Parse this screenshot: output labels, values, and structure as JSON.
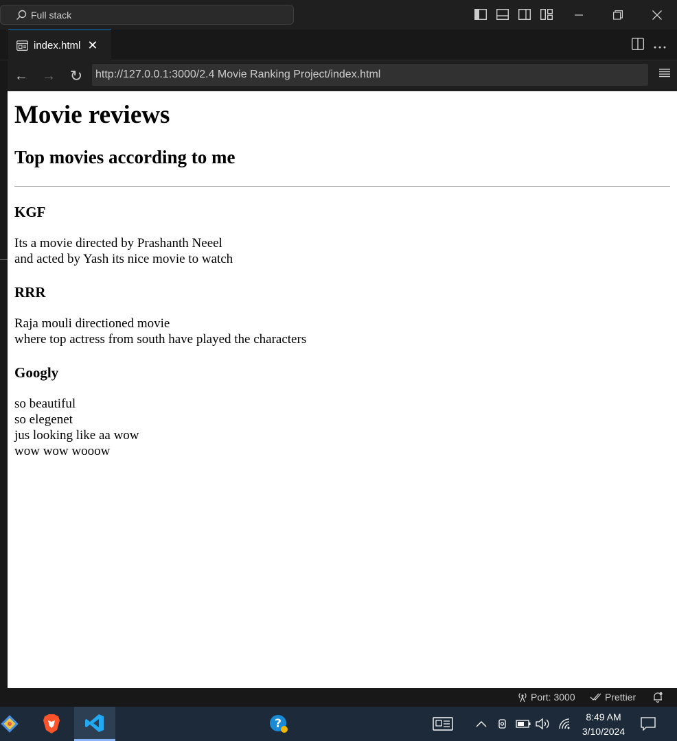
{
  "titlebar": {
    "search_text": "Full stack"
  },
  "tab": {
    "label": "index.html",
    "close_glyph": "✕"
  },
  "browser": {
    "back_glyph": "←",
    "forward_glyph": "→",
    "reload_glyph": "↻",
    "url": "http://127.0.0.1:3000/2.4 Movie Ranking Project/index.html"
  },
  "page": {
    "title": "Movie reviews",
    "subtitle": "Top movies according to me",
    "movies": [
      {
        "name": "KGF",
        "lines": [
          "Its a movie directed by Prashanth Neeel",
          "and acted by Yash its nice movie to watch"
        ]
      },
      {
        "name": "RRR",
        "lines": [
          "Raja mouli directioned movie",
          "where top actress from south have played the characters"
        ]
      },
      {
        "name": "Googly",
        "lines": [
          "so beautiful",
          "so elegenet",
          "jus looking like aa wow",
          "wow wow wooow"
        ]
      }
    ]
  },
  "statusbar": {
    "port": "Port: 3000",
    "prettier": "Prettier"
  },
  "taskbar": {
    "time": "8:49 AM",
    "date": "3/10/2024"
  },
  "colors": {
    "accent": "#0078d4",
    "editor_bg": "#1f1f1f",
    "taskbar_bg": "#1c2a3a"
  }
}
